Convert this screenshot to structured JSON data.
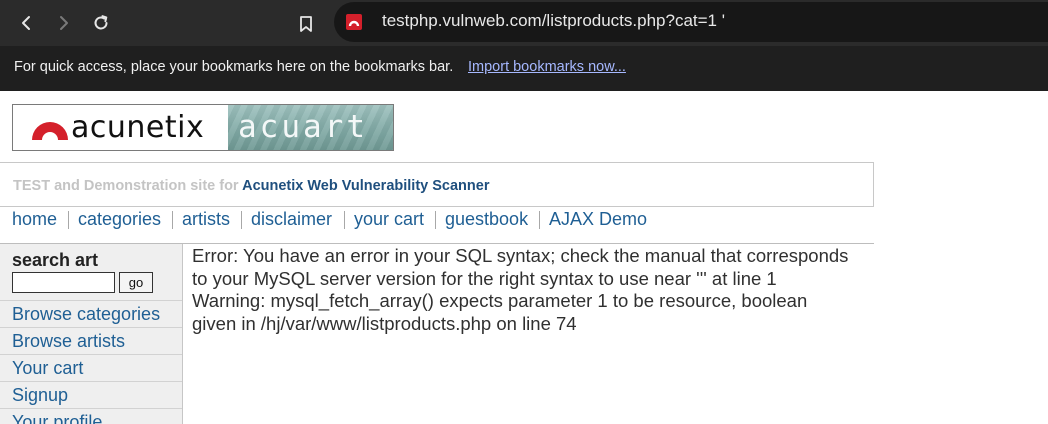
{
  "browser": {
    "url": "testphp.vulnweb.com/listproducts.php?cat=1 '",
    "bookmarks_message": "For quick access, place your bookmarks here on the bookmarks bar.",
    "import_link": "Import bookmarks now...",
    "icons": [
      "back-icon",
      "forward-icon",
      "reload-icon",
      "bookmark-icon",
      "site-favicon"
    ]
  },
  "logo": {
    "left_word": "acunetix",
    "right_word": "acuart",
    "brand_color": "#d4202b"
  },
  "tagline": {
    "prefix": "TEST and Demonstration site for",
    "highlight": "Acunetix Web Vulnerability Scanner"
  },
  "nav": {
    "items": [
      "home",
      "categories",
      "artists",
      "disclaimer",
      "your cart",
      "guestbook",
      "AJAX Demo"
    ]
  },
  "sidebar": {
    "search_title": "search art",
    "search_value": "",
    "go_label": "go",
    "links": [
      "Browse categories",
      "Browse artists",
      "Your cart",
      "Signup",
      "Your profile"
    ]
  },
  "main": {
    "error_message": "Error: You have an error in your SQL syntax; check the manual that corresponds to your MySQL server version for the right syntax to use near ''' at line 1 Warning: mysql_fetch_array() expects parameter 1 to be resource, boolean given in /hj/var/www/listproducts.php on line 74"
  },
  "colors": {
    "link": "#1f5f94",
    "tagline_accent": "#1f4f7e",
    "chrome_dark": "#2b2b2b"
  }
}
